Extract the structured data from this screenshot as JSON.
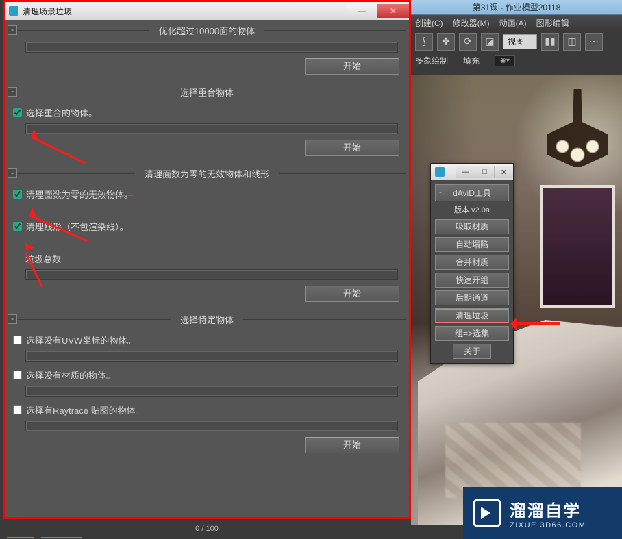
{
  "app": {
    "tab_title": "第31课 - 作业模型20118",
    "menu": {
      "create": "创建(C)",
      "modifiers": "修改器(M)",
      "animation": "动画(A)",
      "graph": "图形编辑"
    },
    "view_dropdown": "视图",
    "substrip": {
      "draw": "多象绘制",
      "fill": "填充"
    }
  },
  "dialog": {
    "title": "清理场景垃圾",
    "btn_start": "开始",
    "sections": {
      "optimize": {
        "title": "优化超过10000面的物体"
      },
      "overlap": {
        "title": "选择重合物体",
        "chk1": "选择重合的物体。"
      },
      "zeroface": {
        "title": "清理面数为零的无效物体和线形",
        "chk1": "清理面数为零的无效物体。",
        "chk2": "清理线形（不包渲染线）。",
        "total_label": "垃圾总数:"
      },
      "specific": {
        "title": "选择特定物体",
        "chk1": "选择没有UVW坐标的物体。",
        "chk2": "选择没有材质的物体。",
        "chk3": "选择有Raytrace 贴图的物体。"
      }
    }
  },
  "palette": {
    "header": "dAviD工具",
    "version": "版本 v2.0a",
    "buttons": {
      "b1": "吸取材质",
      "b2": "自动塌陷",
      "b3": "合并材质",
      "b4": "快速开组",
      "b5": "后期通道",
      "b6": "清理垃圾",
      "b7": "组=>选集",
      "b8": "关于"
    }
  },
  "bottom": {
    "counter": "0 / 100"
  },
  "watermark": {
    "brand": "溜溜自学",
    "url": "ZIXUE.3D66.COM"
  }
}
